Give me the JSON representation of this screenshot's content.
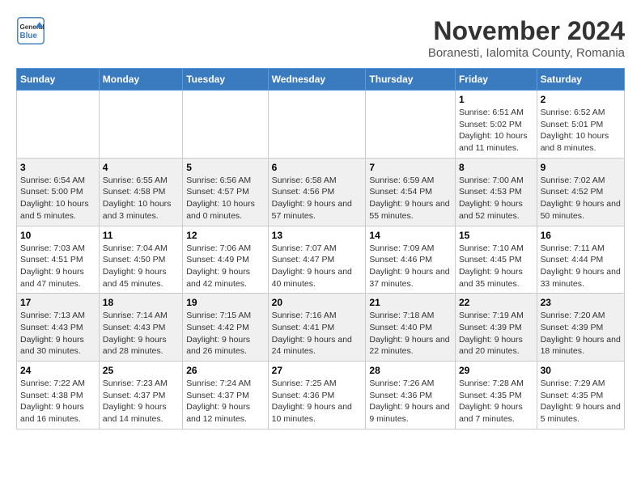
{
  "header": {
    "logo_general": "General",
    "logo_blue": "Blue",
    "main_title": "November 2024",
    "subtitle": "Boranesti, Ialomita County, Romania"
  },
  "days_of_week": [
    "Sunday",
    "Monday",
    "Tuesday",
    "Wednesday",
    "Thursday",
    "Friday",
    "Saturday"
  ],
  "weeks": [
    [
      {
        "day": "",
        "info": ""
      },
      {
        "day": "",
        "info": ""
      },
      {
        "day": "",
        "info": ""
      },
      {
        "day": "",
        "info": ""
      },
      {
        "day": "",
        "info": ""
      },
      {
        "day": "1",
        "info": "Sunrise: 6:51 AM\nSunset: 5:02 PM\nDaylight: 10 hours and 11 minutes."
      },
      {
        "day": "2",
        "info": "Sunrise: 6:52 AM\nSunset: 5:01 PM\nDaylight: 10 hours and 8 minutes."
      }
    ],
    [
      {
        "day": "3",
        "info": "Sunrise: 6:54 AM\nSunset: 5:00 PM\nDaylight: 10 hours and 5 minutes."
      },
      {
        "day": "4",
        "info": "Sunrise: 6:55 AM\nSunset: 4:58 PM\nDaylight: 10 hours and 3 minutes."
      },
      {
        "day": "5",
        "info": "Sunrise: 6:56 AM\nSunset: 4:57 PM\nDaylight: 10 hours and 0 minutes."
      },
      {
        "day": "6",
        "info": "Sunrise: 6:58 AM\nSunset: 4:56 PM\nDaylight: 9 hours and 57 minutes."
      },
      {
        "day": "7",
        "info": "Sunrise: 6:59 AM\nSunset: 4:54 PM\nDaylight: 9 hours and 55 minutes."
      },
      {
        "day": "8",
        "info": "Sunrise: 7:00 AM\nSunset: 4:53 PM\nDaylight: 9 hours and 52 minutes."
      },
      {
        "day": "9",
        "info": "Sunrise: 7:02 AM\nSunset: 4:52 PM\nDaylight: 9 hours and 50 minutes."
      }
    ],
    [
      {
        "day": "10",
        "info": "Sunrise: 7:03 AM\nSunset: 4:51 PM\nDaylight: 9 hours and 47 minutes."
      },
      {
        "day": "11",
        "info": "Sunrise: 7:04 AM\nSunset: 4:50 PM\nDaylight: 9 hours and 45 minutes."
      },
      {
        "day": "12",
        "info": "Sunrise: 7:06 AM\nSunset: 4:49 PM\nDaylight: 9 hours and 42 minutes."
      },
      {
        "day": "13",
        "info": "Sunrise: 7:07 AM\nSunset: 4:47 PM\nDaylight: 9 hours and 40 minutes."
      },
      {
        "day": "14",
        "info": "Sunrise: 7:09 AM\nSunset: 4:46 PM\nDaylight: 9 hours and 37 minutes."
      },
      {
        "day": "15",
        "info": "Sunrise: 7:10 AM\nSunset: 4:45 PM\nDaylight: 9 hours and 35 minutes."
      },
      {
        "day": "16",
        "info": "Sunrise: 7:11 AM\nSunset: 4:44 PM\nDaylight: 9 hours and 33 minutes."
      }
    ],
    [
      {
        "day": "17",
        "info": "Sunrise: 7:13 AM\nSunset: 4:43 PM\nDaylight: 9 hours and 30 minutes."
      },
      {
        "day": "18",
        "info": "Sunrise: 7:14 AM\nSunset: 4:43 PM\nDaylight: 9 hours and 28 minutes."
      },
      {
        "day": "19",
        "info": "Sunrise: 7:15 AM\nSunset: 4:42 PM\nDaylight: 9 hours and 26 minutes."
      },
      {
        "day": "20",
        "info": "Sunrise: 7:16 AM\nSunset: 4:41 PM\nDaylight: 9 hours and 24 minutes."
      },
      {
        "day": "21",
        "info": "Sunrise: 7:18 AM\nSunset: 4:40 PM\nDaylight: 9 hours and 22 minutes."
      },
      {
        "day": "22",
        "info": "Sunrise: 7:19 AM\nSunset: 4:39 PM\nDaylight: 9 hours and 20 minutes."
      },
      {
        "day": "23",
        "info": "Sunrise: 7:20 AM\nSunset: 4:39 PM\nDaylight: 9 hours and 18 minutes."
      }
    ],
    [
      {
        "day": "24",
        "info": "Sunrise: 7:22 AM\nSunset: 4:38 PM\nDaylight: 9 hours and 16 minutes."
      },
      {
        "day": "25",
        "info": "Sunrise: 7:23 AM\nSunset: 4:37 PM\nDaylight: 9 hours and 14 minutes."
      },
      {
        "day": "26",
        "info": "Sunrise: 7:24 AM\nSunset: 4:37 PM\nDaylight: 9 hours and 12 minutes."
      },
      {
        "day": "27",
        "info": "Sunrise: 7:25 AM\nSunset: 4:36 PM\nDaylight: 9 hours and 10 minutes."
      },
      {
        "day": "28",
        "info": "Sunrise: 7:26 AM\nSunset: 4:36 PM\nDaylight: 9 hours and 9 minutes."
      },
      {
        "day": "29",
        "info": "Sunrise: 7:28 AM\nSunset: 4:35 PM\nDaylight: 9 hours and 7 minutes."
      },
      {
        "day": "30",
        "info": "Sunrise: 7:29 AM\nSunset: 4:35 PM\nDaylight: 9 hours and 5 minutes."
      }
    ]
  ]
}
